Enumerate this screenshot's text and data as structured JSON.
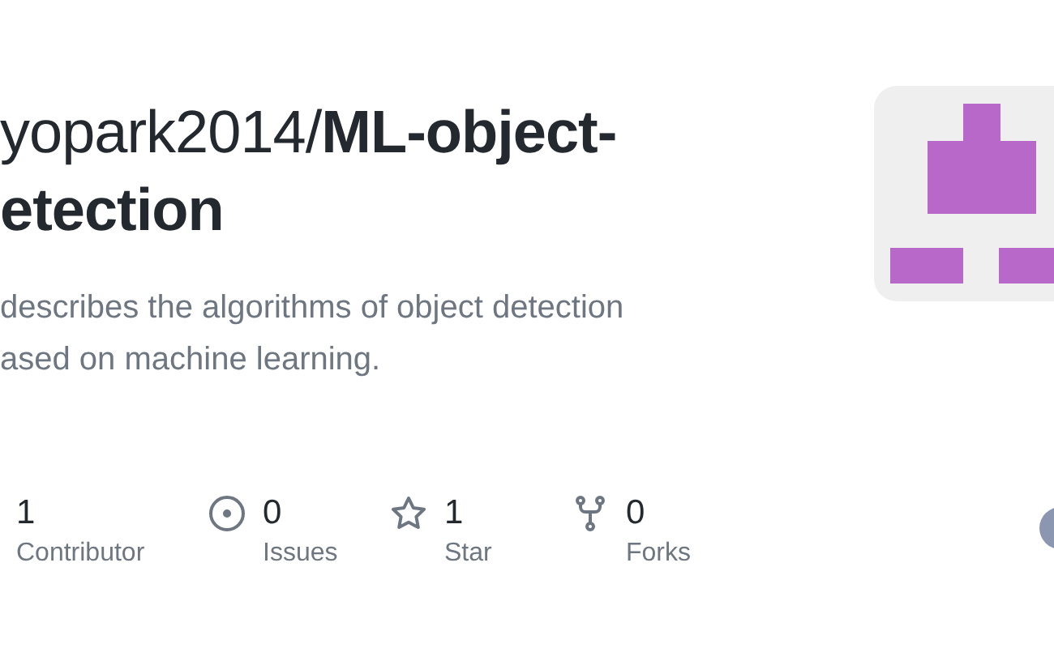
{
  "repo": {
    "owner": "yopark2014/",
    "name": "ML-object-",
    "name_line_2": "etection"
  },
  "description": [
    "describes the algorithms of object detection",
    "ased on machine learning."
  ],
  "stats": [
    {
      "kind": "contributors",
      "count": "1",
      "label": "Contributor"
    },
    {
      "kind": "issues",
      "count": "0",
      "label": "Issues"
    },
    {
      "kind": "stars",
      "count": "1",
      "label": "Star"
    },
    {
      "kind": "forks",
      "count": "0",
      "label": "Forks"
    }
  ]
}
